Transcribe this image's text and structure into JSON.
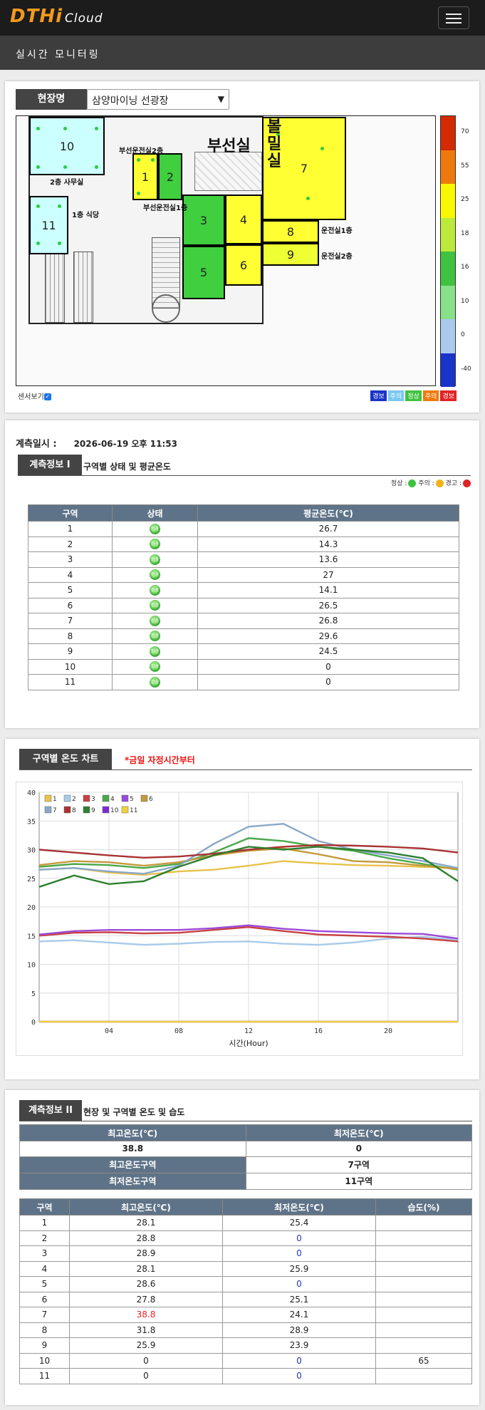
{
  "app": {
    "logo": "DTHi",
    "logo_sub": "Cloud",
    "page_title": "실시간 모니터링"
  },
  "site": {
    "label": "현장명",
    "selected": "삼양마이닝 선광장"
  },
  "map": {
    "labels": {
      "office2": "2층 사무실",
      "cafeteria": "1층 식당",
      "flotation_room2": "부선운전실2층",
      "flotation_room1": "부선운전실1층",
      "flotation": "부선실",
      "ballmill": "볼밀실",
      "control1": "운전실1층",
      "control2": "운전실2층"
    },
    "zones": [
      {
        "id": "1",
        "color": "#ffff33"
      },
      {
        "id": "2",
        "color": "#3fcf3f"
      },
      {
        "id": "3",
        "color": "#3fcf3f"
      },
      {
        "id": "4",
        "color": "#ffff33"
      },
      {
        "id": "5",
        "color": "#3fcf3f"
      },
      {
        "id": "6",
        "color": "#ffff33"
      },
      {
        "id": "7",
        "color": "#ffff33"
      },
      {
        "id": "8",
        "color": "#ffff33"
      },
      {
        "id": "9",
        "color": "#eeff33"
      },
      {
        "id": "10",
        "color": "#ccffff"
      },
      {
        "id": "11",
        "color": "#ccffff"
      }
    ],
    "scale": [
      {
        "label": "70",
        "color": "#d42a00"
      },
      {
        "label": "55",
        "color": "#ee7a0e"
      },
      {
        "label": "25",
        "color": "#f8f800"
      },
      {
        "label": "18",
        "color": "#bcea3c"
      },
      {
        "label": "16",
        "color": "#3fc23f"
      },
      {
        "label": "10",
        "color": "#88e08a"
      },
      {
        "label": "0",
        "color": "#a9c9ee"
      },
      {
        "label": "-40",
        "color": "#1a33c8"
      }
    ],
    "sensor_view_label": "센서보기",
    "legend": [
      {
        "label": "경보",
        "color": "#1a33c8"
      },
      {
        "label": "주의",
        "color": "#7ac8f2"
      },
      {
        "label": "정상",
        "color": "#3fc23f"
      },
      {
        "label": "주의",
        "color": "#ee7a0e"
      },
      {
        "label": "경보",
        "color": "#e02424"
      }
    ]
  },
  "measurement": {
    "time_label": "계측일시 :",
    "time_value": "2026-06-19 오후 11:53",
    "info1_title": "계측정보 I",
    "info1_sub": "구역별 상태 및 평균온도",
    "status_legend": [
      "정상 :",
      "주의 :",
      "경고 :"
    ],
    "table1": {
      "headers": [
        "구역",
        "상태",
        "평균온도(℃)"
      ],
      "status_icon_text": "정상",
      "rows": [
        {
          "zone": "1",
          "avg": "26.7"
        },
        {
          "zone": "2",
          "avg": "14.3"
        },
        {
          "zone": "3",
          "avg": "13.6"
        },
        {
          "zone": "4",
          "avg": "27"
        },
        {
          "zone": "5",
          "avg": "14.1"
        },
        {
          "zone": "6",
          "avg": "26.5"
        },
        {
          "zone": "7",
          "avg": "26.8"
        },
        {
          "zone": "8",
          "avg": "29.6"
        },
        {
          "zone": "9",
          "avg": "24.5"
        },
        {
          "zone": "10",
          "avg": "0"
        },
        {
          "zone": "11",
          "avg": "0"
        }
      ]
    }
  },
  "chart_section": {
    "title": "구역별 온도 차트",
    "note": "*금일 자정시간부터"
  },
  "chart_data": {
    "type": "line",
    "xlabel": "시간(Hour)",
    "ylabel": "",
    "xlim": [
      0,
      24
    ],
    "ylim": [
      0,
      40
    ],
    "xticks": [
      "04",
      "08",
      "12",
      "16",
      "20"
    ],
    "yticks": [
      0,
      5,
      10,
      15,
      20,
      25,
      30,
      35,
      40
    ],
    "grid": true,
    "legend_position": "top-left",
    "x": [
      0,
      2,
      4,
      6,
      8,
      10,
      12,
      14,
      16,
      18,
      20,
      22,
      24
    ],
    "series": [
      {
        "name": "1",
        "color": "#e8c24a",
        "values": [
          26.5,
          26.8,
          26.0,
          25.6,
          26.2,
          26.5,
          27.2,
          28.0,
          27.6,
          27.3,
          27.2,
          27.0,
          26.8
        ]
      },
      {
        "name": "2",
        "color": "#a9cbe8",
        "values": [
          14.0,
          14.2,
          13.8,
          13.4,
          13.6,
          13.9,
          14.0,
          13.6,
          13.4,
          13.8,
          14.5,
          14.8,
          14.3
        ]
      },
      {
        "name": "3",
        "color": "#c84040",
        "values": [
          15.0,
          15.5,
          15.6,
          15.4,
          15.5,
          16.0,
          16.5,
          15.8,
          15.2,
          15.0,
          14.8,
          14.5,
          14.0
        ]
      },
      {
        "name": "4",
        "color": "#4aa84a",
        "values": [
          27.0,
          27.5,
          27.3,
          26.8,
          27.5,
          29.5,
          32.0,
          31.5,
          30.5,
          29.8,
          28.5,
          27.5,
          26.5
        ]
      },
      {
        "name": "5",
        "color": "#9b4ad8",
        "values": [
          15.2,
          15.8,
          16.0,
          16.0,
          16.0,
          16.3,
          16.8,
          16.2,
          15.8,
          15.6,
          15.4,
          15.3,
          14.5
        ]
      },
      {
        "name": "6",
        "color": "#c49a3c",
        "values": [
          27.3,
          28.0,
          27.8,
          27.2,
          27.8,
          29.0,
          29.8,
          30.2,
          29.2,
          28.0,
          27.8,
          27.2,
          26.6
        ]
      },
      {
        "name": "7",
        "color": "#8aa8c8",
        "values": [
          26.5,
          26.8,
          26.2,
          25.8,
          27.2,
          31.0,
          34.0,
          34.5,
          31.5,
          30.0,
          29.0,
          28.0,
          26.8
        ]
      },
      {
        "name": "8",
        "color": "#a83232",
        "values": [
          30.0,
          29.5,
          29.0,
          28.6,
          28.8,
          29.3,
          30.0,
          30.5,
          30.8,
          30.7,
          30.5,
          30.2,
          29.5
        ]
      },
      {
        "name": "9",
        "color": "#2f7f2f",
        "values": [
          23.5,
          25.5,
          24.0,
          24.5,
          27.0,
          29.0,
          30.5,
          30.0,
          30.5,
          30.0,
          29.5,
          28.5,
          24.5
        ]
      },
      {
        "name": "10",
        "color": "#7b2ad8",
        "values": [
          0,
          0,
          0,
          0,
          0,
          0,
          0,
          0,
          0,
          0,
          0,
          0,
          0
        ]
      },
      {
        "name": "11",
        "color": "#f0d040",
        "values": [
          0,
          0,
          0,
          0,
          0,
          0,
          0,
          0,
          0,
          0,
          0,
          0,
          0
        ]
      }
    ]
  },
  "info2": {
    "title": "계측정보 II",
    "sub": "현장 및 구역별 온도 및 습도",
    "summary_headers": [
      "최고온도(℃)",
      "최저온도(℃)"
    ],
    "summary_values": [
      "38.8",
      "0"
    ],
    "max_zone_label": "최고온도구역",
    "max_zone_value": "7구역",
    "min_zone_label": "최저온도구역",
    "min_zone_value": "11구역",
    "table": {
      "headers": [
        "구역",
        "최고온도(℃)",
        "최저온도(℃)",
        "습도(%)"
      ],
      "rows": [
        {
          "zone": "1",
          "max": "28.1",
          "min": "25.4",
          "hum": ""
        },
        {
          "zone": "2",
          "max": "28.8",
          "min": "0",
          "hum": ""
        },
        {
          "zone": "3",
          "max": "28.9",
          "min": "0",
          "hum": ""
        },
        {
          "zone": "4",
          "max": "28.1",
          "min": "25.9",
          "hum": ""
        },
        {
          "zone": "5",
          "max": "28.6",
          "min": "0",
          "hum": ""
        },
        {
          "zone": "6",
          "max": "27.8",
          "min": "25.1",
          "hum": ""
        },
        {
          "zone": "7",
          "max": "38.8",
          "min": "24.1",
          "hum": ""
        },
        {
          "zone": "8",
          "max": "31.8",
          "min": "28.9",
          "hum": ""
        },
        {
          "zone": "9",
          "max": "25.9",
          "min": "23.9",
          "hum": ""
        },
        {
          "zone": "10",
          "max": "0",
          "min": "0",
          "hum": "65"
        },
        {
          "zone": "11",
          "max": "0",
          "min": "0",
          "hum": ""
        }
      ]
    }
  }
}
